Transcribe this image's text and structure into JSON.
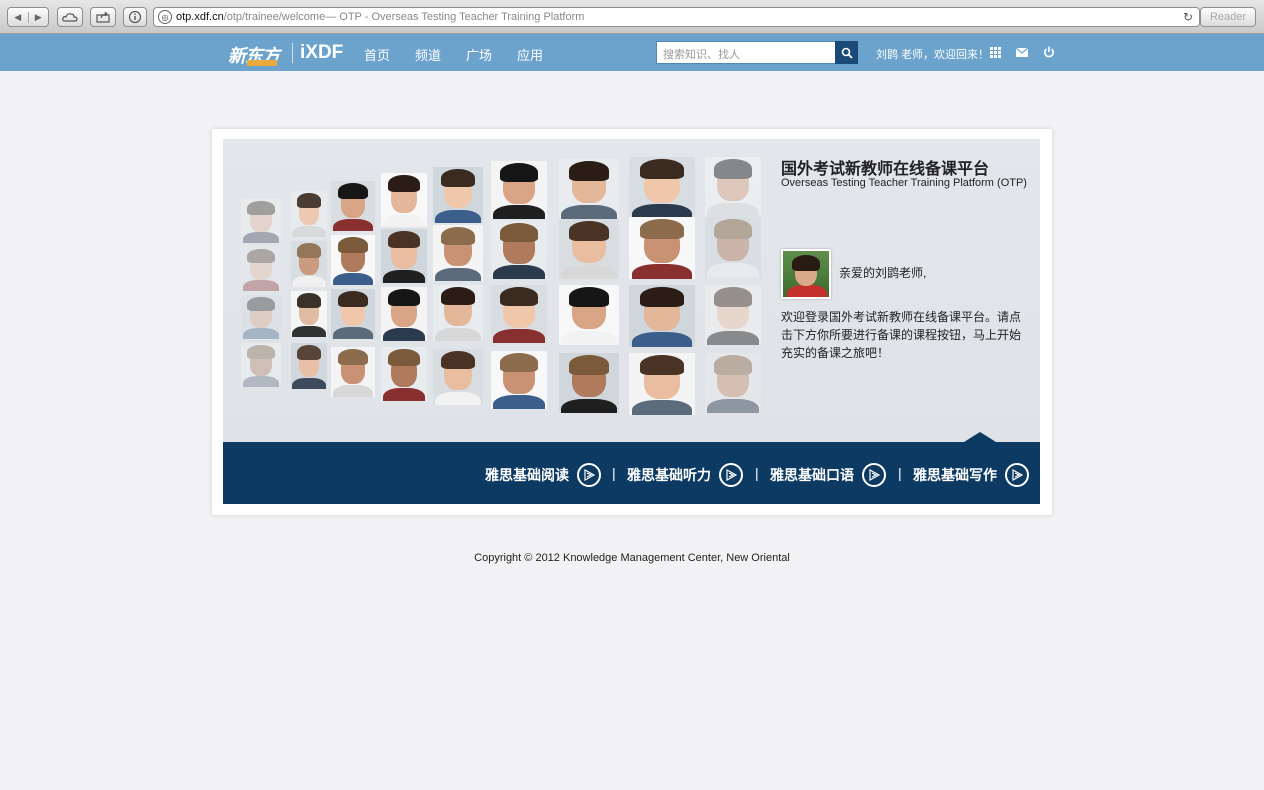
{
  "browser": {
    "url_host": "otp.xdf.cn",
    "url_path": "/otp/trainee/welcome",
    "url_title": " — OTP - Overseas Testing Teacher Training Platform",
    "reader_label": "Reader"
  },
  "header": {
    "logo_xdf": "新东方",
    "logo_ixdf": "iXDF",
    "nav": [
      "首页",
      "频道",
      "广场",
      "应用"
    ],
    "search_placeholder": "搜索知识、找人",
    "greeting": "刘鹍 老师，欢迎回来！",
    "accent_color": "#6ba3cd"
  },
  "hero": {
    "title": "国外考试新教师在线备课平台",
    "subtitle": "Overseas Testing Teacher Training Platform (OTP)",
    "dear": "亲爱的刘鹍老师,",
    "welcome": "欢迎登录国外考试新教师在线备课平台。请点击下方你所要进行备课的课程按钮，马上开始充实的备课之旅吧！"
  },
  "courses": [
    {
      "label": "雅思基础阅读"
    },
    {
      "label": "雅思基础听力"
    },
    {
      "label": "雅思基础口语"
    },
    {
      "label": "雅思基础写作"
    }
  ],
  "separator": "|",
  "footer": {
    "copyright": "Copyright © 2012 Knowledge Management Center, New Oriental"
  }
}
